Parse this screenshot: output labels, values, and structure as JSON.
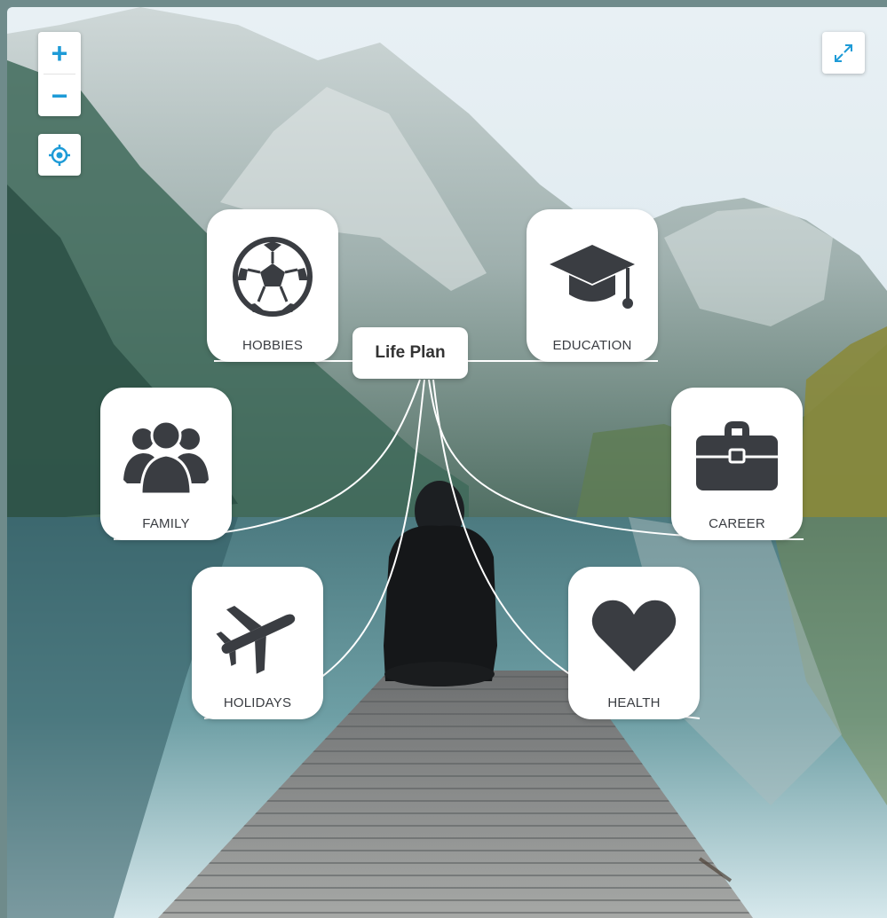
{
  "map": {
    "root_label": "Life Plan",
    "nodes": [
      {
        "label": "HOBBIES",
        "icon": "soccer-ball-icon"
      },
      {
        "label": "EDUCATION",
        "icon": "graduation-cap-icon"
      },
      {
        "label": "FAMILY",
        "icon": "group-icon"
      },
      {
        "label": "CAREER",
        "icon": "briefcase-icon"
      },
      {
        "label": "HOLIDAYS",
        "icon": "airplane-icon"
      },
      {
        "label": "HEALTH",
        "icon": "heart-icon"
      }
    ]
  },
  "controls": {
    "zoom_in": "+",
    "zoom_out": "−",
    "locate_icon": "crosshair-icon",
    "fullscreen_icon": "expand-icon"
  },
  "colors": {
    "accent": "#1e9bd7",
    "icon": "#3a3d42",
    "connector": "#ffffff",
    "water": "#5d8e95",
    "sky": "#dfeaf0"
  }
}
